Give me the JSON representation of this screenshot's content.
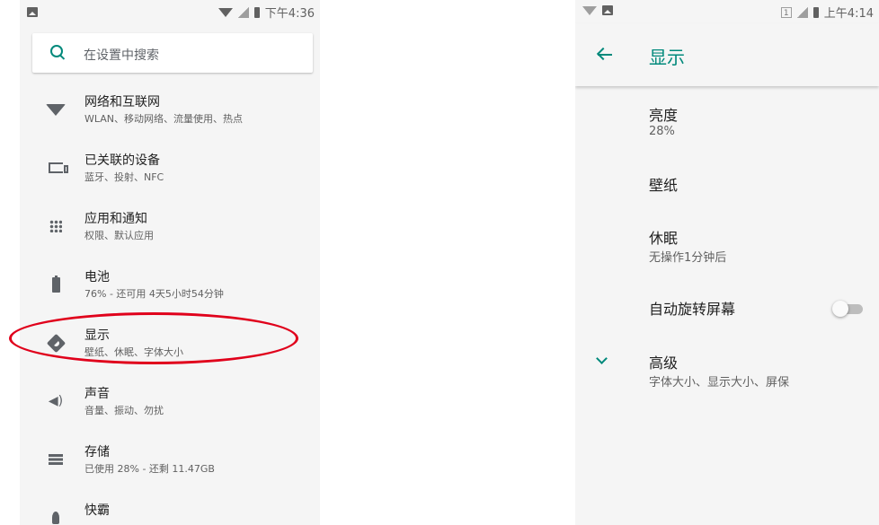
{
  "left_screen": {
    "status": {
      "time": "下午4:36"
    },
    "search": {
      "placeholder": "在设置中搜索"
    },
    "items": [
      {
        "title": "网络和互联网",
        "subtitle": "WLAN、移动网络、流量使用、热点",
        "icon": "wifi-icon"
      },
      {
        "title": "已关联的设备",
        "subtitle": "蓝牙、投射、NFC",
        "icon": "connected-devices-icon"
      },
      {
        "title": "应用和通知",
        "subtitle": "权限、默认应用",
        "icon": "apps-grid-icon"
      },
      {
        "title": "电池",
        "subtitle": "76% - 还可用 4天5小时54分钟",
        "icon": "battery-icon"
      },
      {
        "title": "显示",
        "subtitle": "壁纸、休眠、字体大小",
        "icon": "brightness-icon"
      },
      {
        "title": "声音",
        "subtitle": "音量、振动、勿扰",
        "icon": "volume-icon"
      },
      {
        "title": "存储",
        "subtitle": "已使用 28% - 还剩 11.47GB",
        "icon": "storage-icon"
      },
      {
        "title": "快霸",
        "subtitle": "",
        "icon": "rocket-icon"
      }
    ],
    "highlight_color": "#e0001b"
  },
  "right_screen": {
    "status": {
      "sim_badge": "1",
      "time": "上午4:14"
    },
    "title": "显示",
    "items": [
      {
        "title": "亮度",
        "subtitle": "28%"
      },
      {
        "title": "壁纸",
        "subtitle": ""
      },
      {
        "title": "休眠",
        "subtitle": "无操作1分钟后"
      },
      {
        "title": "自动旋转屏幕",
        "toggle_on": false
      },
      {
        "title": "高级",
        "subtitle": "字体大小、显示大小、屏保"
      }
    ]
  },
  "colors": {
    "accent": "#00897b",
    "background": "#f5f5f5"
  }
}
